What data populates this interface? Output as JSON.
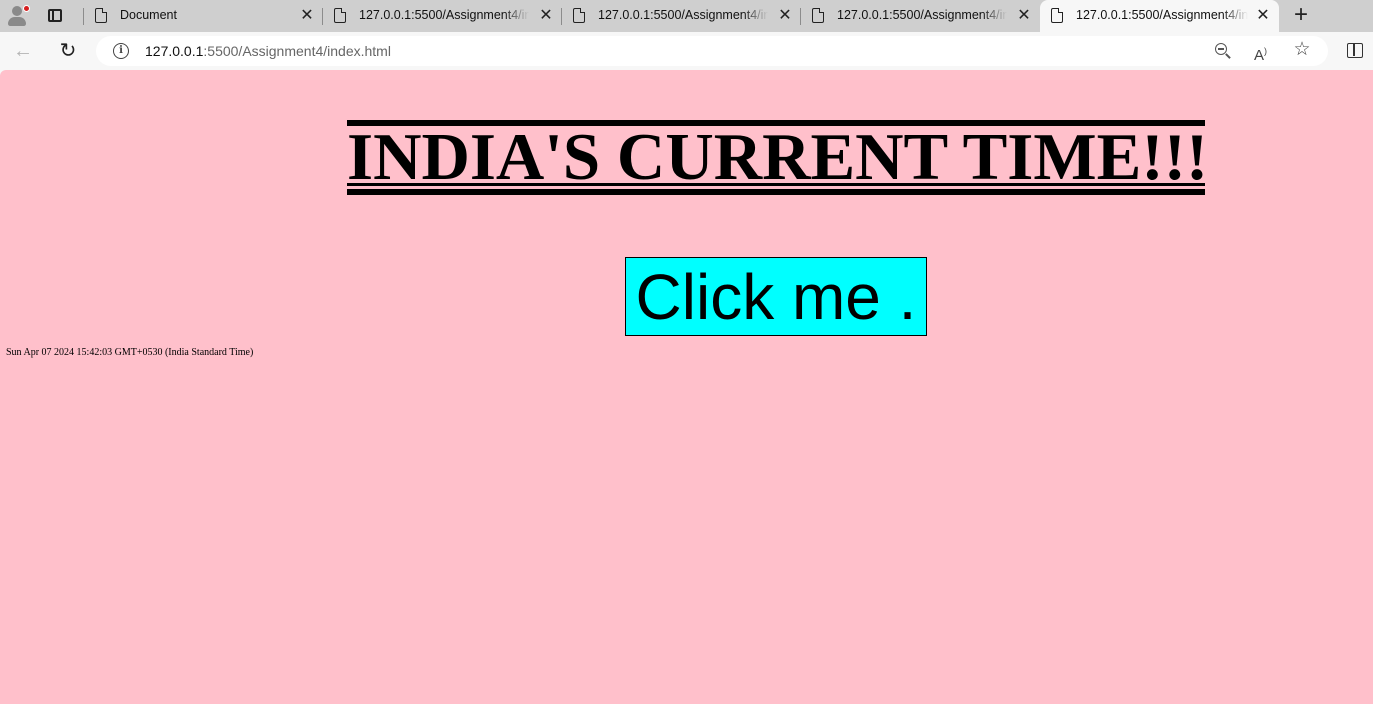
{
  "browser": {
    "tabs": [
      {
        "title": "Document",
        "active": false
      },
      {
        "title": "127.0.0.1:5500/Assignment4/index.html",
        "active": false
      },
      {
        "title": "127.0.0.1:5500/Assignment4/index.html",
        "active": false
      },
      {
        "title": "127.0.0.1:5500/Assignment4/index.html",
        "active": false
      },
      {
        "title": "127.0.0.1:5500/Assignment4/index.html",
        "active": true
      }
    ],
    "tab_close_glyph": "✕",
    "new_tab_glyph": "+",
    "address": {
      "host": "127.0.0.1",
      "rest": ":5500/Assignment4/index.html"
    },
    "icons": {
      "profile": "profile-avatar-icon",
      "tab_actions": "tab-actions-icon",
      "page": "document-icon",
      "back": "back-arrow-icon",
      "reload": "reload-icon",
      "info": "info-icon",
      "zoom": "zoom-out-icon",
      "read_aloud": "read-aloud-icon",
      "favorite": "star-icon",
      "split": "split-screen-icon"
    }
  },
  "page": {
    "background": "#ffc0cb",
    "heading": "INDIA'S CURRENT TIME!!!",
    "button_label": "Click me .",
    "button_color": "#00ffff",
    "current_time": "Sun Apr 07 2024 15:42:03 GMT+0530 (India Standard Time)"
  }
}
